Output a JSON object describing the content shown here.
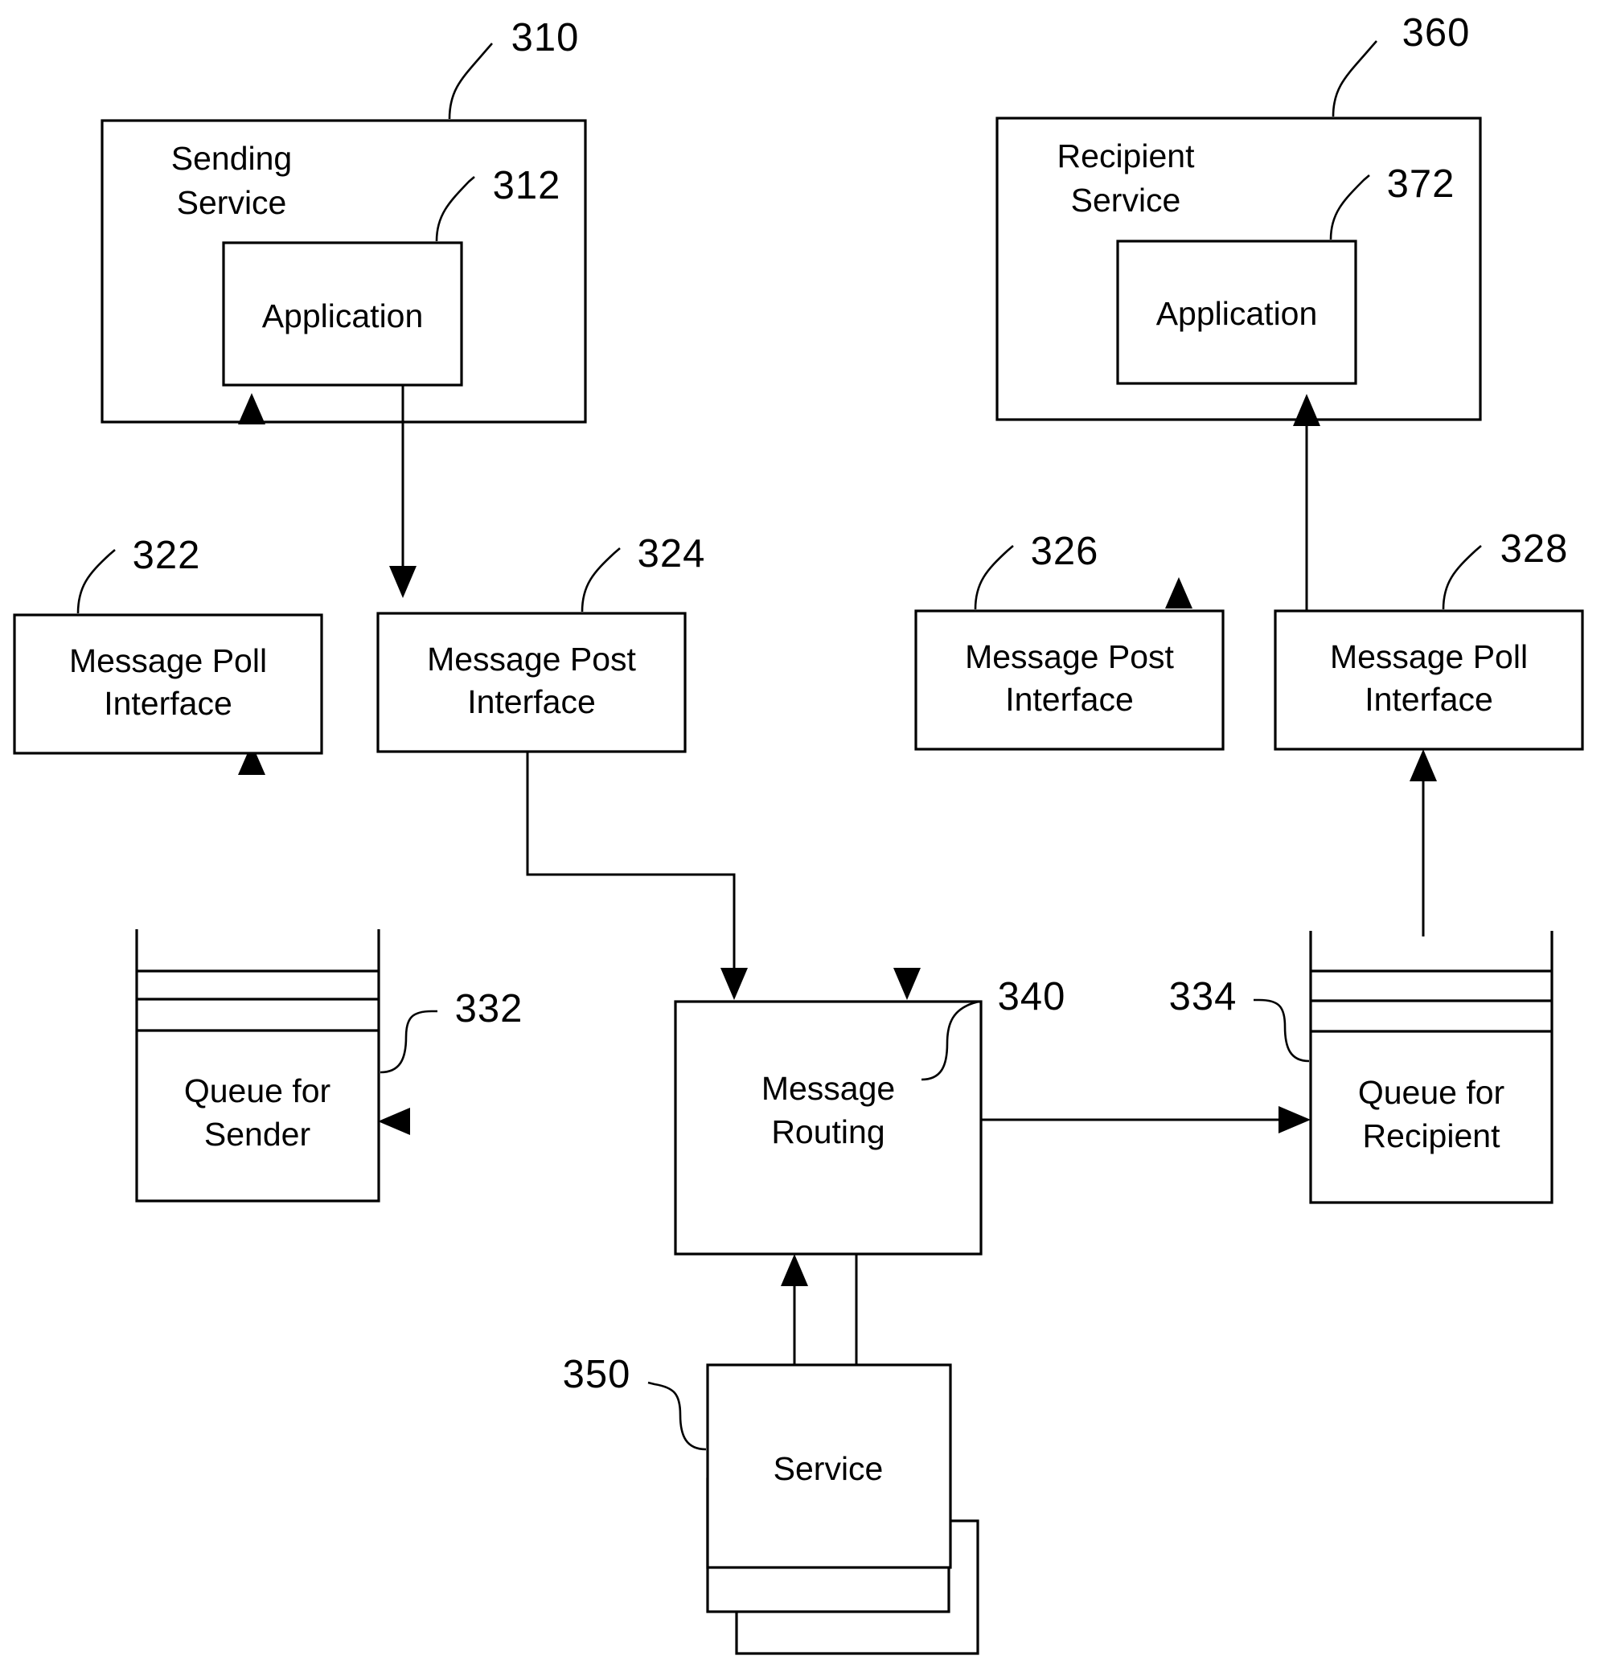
{
  "figure": {
    "type": "patent-block-diagram",
    "background_color": "#ffffff",
    "line_color": "#000000"
  },
  "nodes": {
    "sending_service": {
      "label_line1": "Sending",
      "label_line2": "Service",
      "ref": "310"
    },
    "sending_application": {
      "label": "Application",
      "ref": "312"
    },
    "recipient_service": {
      "label_line1": "Recipient",
      "label_line2": "Service",
      "ref": "360"
    },
    "recipient_application": {
      "label": "Application",
      "ref": "372"
    },
    "sender_message_poll_interface": {
      "label_line1": "Message Poll",
      "label_line2": "Interface",
      "ref": "322"
    },
    "sender_message_post_interface": {
      "label_line1": "Message Post",
      "label_line2": "Interface",
      "ref": "324"
    },
    "recipient_message_post_interface": {
      "label_line1": "Message Post",
      "label_line2": "Interface",
      "ref": "326"
    },
    "recipient_message_poll_interface": {
      "label_line1": "Message Poll",
      "label_line2": "Interface",
      "ref": "328"
    },
    "queue_for_sender": {
      "label_line1": "Queue for",
      "label_line2": "Sender",
      "ref": "332"
    },
    "queue_for_recipient": {
      "label_line1": "Queue for",
      "label_line2": "Recipient",
      "ref": "334"
    },
    "message_routing": {
      "label_line1": "Message",
      "label_line2": "Routing",
      "ref": "340"
    },
    "service": {
      "label": "Service",
      "ref": "350"
    }
  },
  "reference_numerals": [
    "310",
    "312",
    "322",
    "324",
    "326",
    "328",
    "332",
    "334",
    "340",
    "350",
    "360",
    "372"
  ],
  "connections": [
    {
      "from": "sending_application",
      "to": "sender_message_post_interface",
      "direction": "down"
    },
    {
      "from": "sender_message_poll_interface",
      "to": "sending_application",
      "direction": "up"
    },
    {
      "from": "sender_message_post_interface",
      "to": "message_routing",
      "direction": "down-elbow"
    },
    {
      "from": "message_routing",
      "to": "queue_for_sender",
      "direction": "left"
    },
    {
      "from": "message_routing",
      "to": "queue_for_recipient",
      "direction": "right"
    },
    {
      "from": "queue_for_recipient",
      "to": "recipient_message_poll_interface",
      "direction": "up"
    },
    {
      "from": "recipient_message_poll_interface",
      "to": "recipient_application",
      "direction": "up"
    },
    {
      "from": "recipient_message_post_interface",
      "to": "message_routing",
      "direction": "down"
    },
    {
      "from": "service",
      "to": "message_routing",
      "direction": "up"
    },
    {
      "from": "message_routing",
      "to": "service",
      "direction": "down"
    }
  ]
}
